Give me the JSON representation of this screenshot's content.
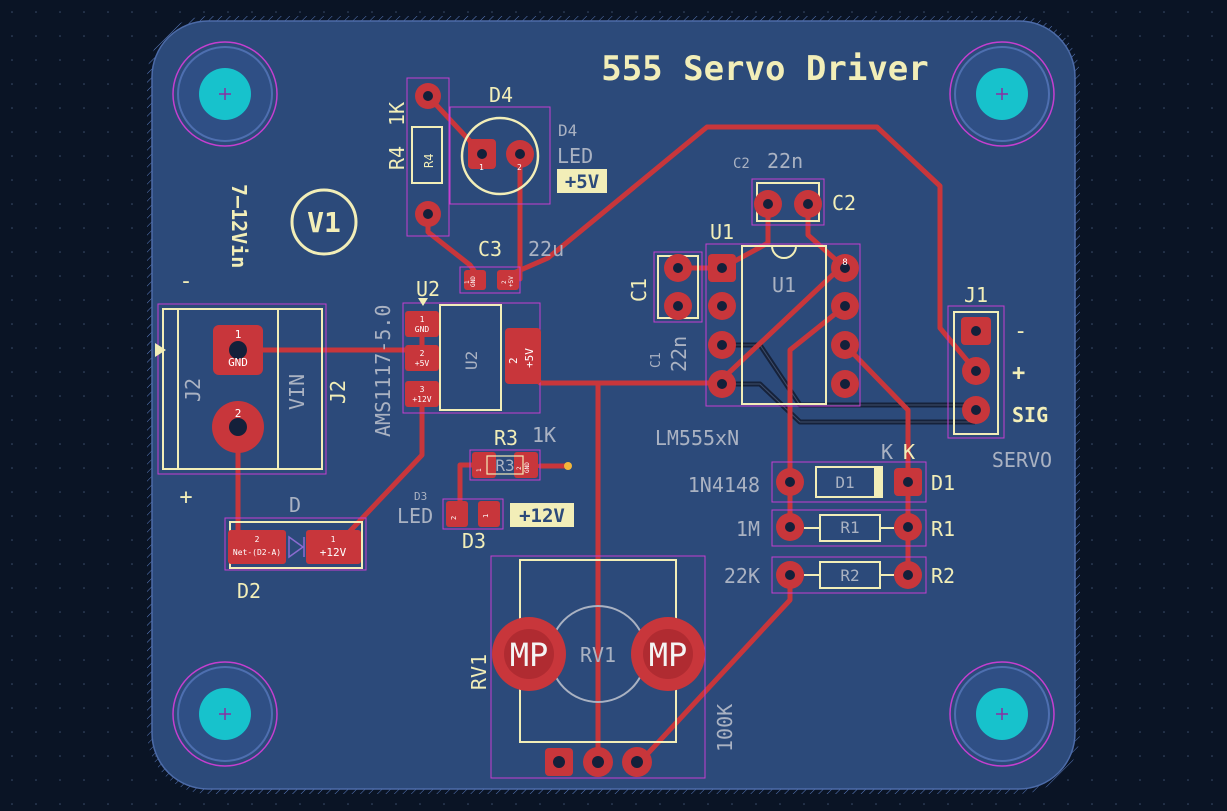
{
  "board": {
    "title": "555 Servo Driver",
    "version_mark": "V1",
    "input_voltage": "7–12Vin",
    "minus": "-",
    "plus": "+"
  },
  "components": {
    "D4": {
      "ref": "D4",
      "ref2": "D4",
      "value": "LED",
      "tag": "+5V",
      "pad1": "1",
      "pad2": "2"
    },
    "R4": {
      "ref": "R4",
      "value": "1K",
      "body": "R4"
    },
    "C3": {
      "ref": "C3",
      "value": "22u",
      "pad1": "1",
      "pad1_net": "GND",
      "pad2": "2",
      "pad2_net": "+5V"
    },
    "U2": {
      "ref": "U2",
      "value": "AMS1117-5.0",
      "body": "U2",
      "pins": [
        {
          "num": "1",
          "net": "GND"
        },
        {
          "num": "2",
          "net": "+5V"
        },
        {
          "num": "3",
          "net": "+12V"
        }
      ],
      "tab_num": "2",
      "tab_net": "+5V"
    },
    "J2": {
      "ref": "J2",
      "body": "J2",
      "vin": "VIN",
      "pad1": "1",
      "pad1_net": "GND",
      "pad2": "2"
    },
    "D2": {
      "ref": "D2",
      "body": "D",
      "pad1": "1",
      "pad1_net": "+12V",
      "pad2": "2",
      "pad2_net": "Net-(D2-A)"
    },
    "R3": {
      "ref": "R3",
      "value": "1K",
      "body": "R3",
      "pad1": "1",
      "pad2": "2",
      "pad2_net": "GND"
    },
    "D3": {
      "ref": "D3",
      "ref_small": "D3",
      "value": "LED",
      "tag": "+12V",
      "pad1": "1",
      "pad2": "2"
    },
    "C2": {
      "ref": "C2",
      "ref_small": "C2",
      "value": "22n"
    },
    "C1": {
      "ref": "C1",
      "ref_small": "C1",
      "value": "22n"
    },
    "U1": {
      "ref": "U1",
      "body": "U1",
      "value": "LM555xN",
      "pin8": "8"
    },
    "J1": {
      "ref": "J1",
      "minus": "-",
      "plus": "+",
      "sig": "SIG",
      "value": "SERVO"
    },
    "D1": {
      "ref": "D1",
      "body": "D1",
      "value": "1N4148",
      "k1": "K",
      "k2": "K"
    },
    "R1": {
      "ref": "R1",
      "body": "R1",
      "value": "1M"
    },
    "R2": {
      "ref": "R2",
      "body": "R2",
      "value": "22K"
    },
    "RV1": {
      "ref": "RV1",
      "body": "RV1",
      "value": "100K",
      "mp": "MP"
    }
  },
  "colors": {
    "background": "#0a1425",
    "board": "#2c4a7a",
    "copper": "#c8363b",
    "silkscreen": "#f2eeb8",
    "courtyard": "#c53fd0",
    "mounting_hole": "#17c2cc"
  }
}
